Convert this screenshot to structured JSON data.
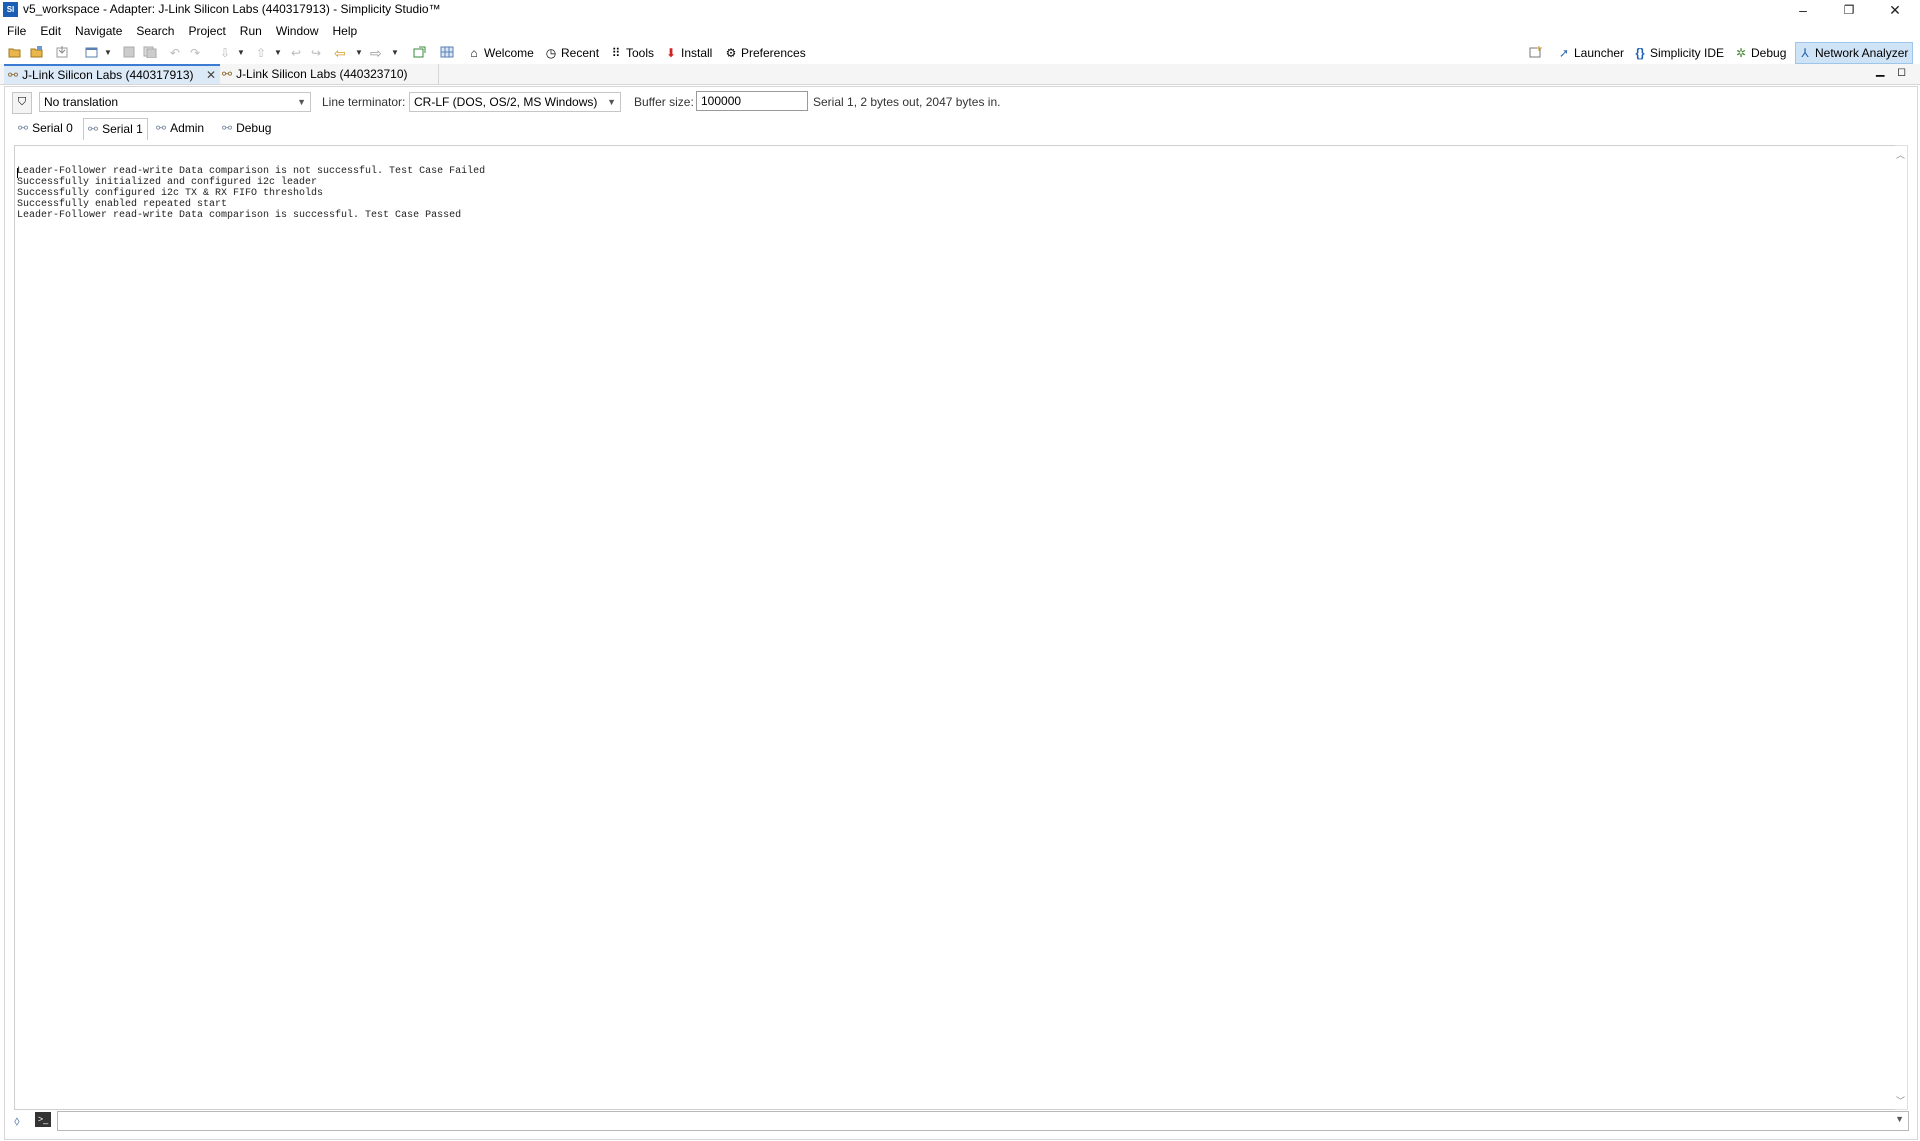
{
  "window": {
    "title": "v5_workspace - Adapter: J-Link Silicon Labs (440317913) - Simplicity Studio™",
    "logo": "SI",
    "minimize": "–",
    "restore": "❐",
    "close": "✕"
  },
  "menu": [
    "File",
    "Edit",
    "Navigate",
    "Search",
    "Project",
    "Run",
    "Window",
    "Help"
  ],
  "toolbar": {
    "welcome": "Welcome",
    "recent": "Recent",
    "tools": "Tools",
    "install": "Install",
    "preferences": "Preferences",
    "launcher": "Launcher",
    "simplicity_ide": "Simplicity IDE",
    "debug": "Debug",
    "network_analyzer": "Network Analyzer"
  },
  "editor_tabs": [
    {
      "label": "J-Link Silicon Labs (440317913)",
      "active": true
    },
    {
      "label": "J-Link Silicon Labs (440323710)",
      "active": false
    }
  ],
  "settings": {
    "translation": "No translation",
    "line_terminator_label": "Line terminator:",
    "line_terminator": "CR-LF  (DOS, OS/2, MS Windows)",
    "buffer_size_label": "Buffer size:",
    "buffer_size": "100000",
    "status": "Serial 1, 2 bytes out, 2047 bytes in."
  },
  "serial_tabs": [
    {
      "label": "Serial 0",
      "active": false
    },
    {
      "label": "Serial 1",
      "active": true
    },
    {
      "label": "Admin",
      "active": false
    },
    {
      "label": "Debug",
      "active": false
    }
  ],
  "console_lines": [
    "Leader-Follower read-write Data comparison is not successful. Test Case Failed",
    "Successfully initialized and configured i2c leader",
    "Successfully configured i2c TX & RX FIFO thresholds",
    "Successfully enabled repeated start",
    "Leader-Follower read-write Data comparison is successful. Test Case Passed"
  ],
  "colors": {
    "accent": "#3b7bd1",
    "active_tab_bg": "#dce9f6",
    "network_analyzer_bg": "#cfe3f6"
  }
}
